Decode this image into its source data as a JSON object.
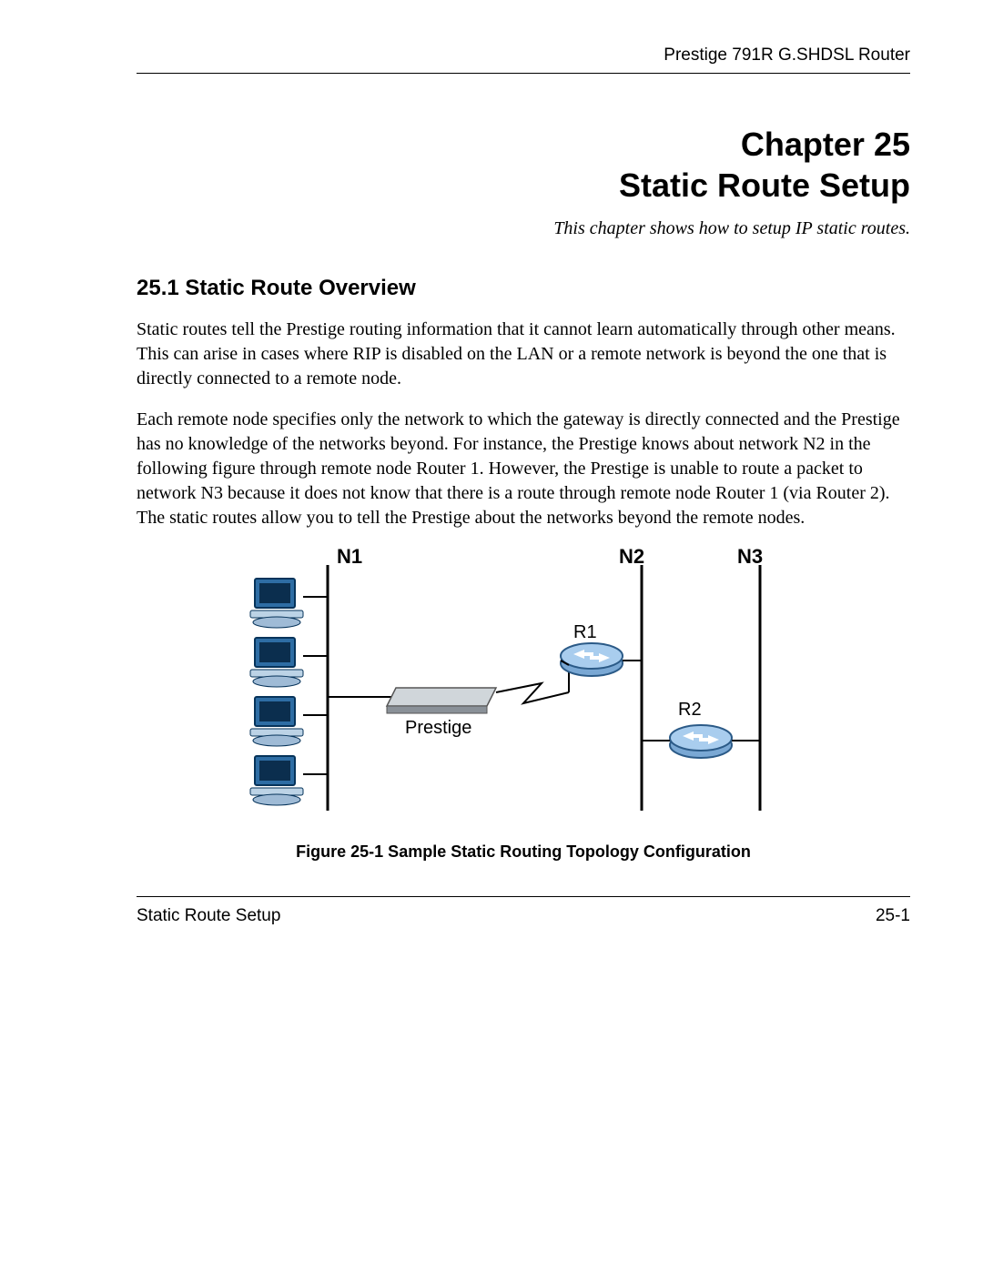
{
  "header": {
    "product": "Prestige 791R G.SHDSL Router"
  },
  "chapter": {
    "line": "Chapter 25",
    "title": "Static Route Setup",
    "subtitle": "This chapter shows how to setup IP static routes."
  },
  "section": {
    "heading": "25.1  Static Route Overview",
    "para1": "Static routes tell the Prestige routing information that it cannot learn automatically through other means. This can arise in cases where RIP is disabled on the LAN or a remote network is beyond the one that is directly connected to a remote node.",
    "para2": "Each remote node specifies only the network to which the gateway is directly connected and the Prestige has no knowledge of the networks beyond. For instance, the Prestige knows about network N2 in the following figure through remote node Router 1. However, the Prestige is unable to route a packet to network N3 because it does not know that there is a route through remote node Router 1 (via Router 2). The static routes allow you to tell the Prestige about the networks beyond the remote nodes."
  },
  "figure": {
    "labels": {
      "n1": "N1",
      "n2": "N2",
      "n3": "N3",
      "r1": "R1",
      "r2": "R2",
      "device": "Prestige"
    },
    "caption": "Figure 25-1 Sample Static Routing Topology Configuration"
  },
  "footer": {
    "left": "Static Route Setup",
    "right": "25-1"
  }
}
